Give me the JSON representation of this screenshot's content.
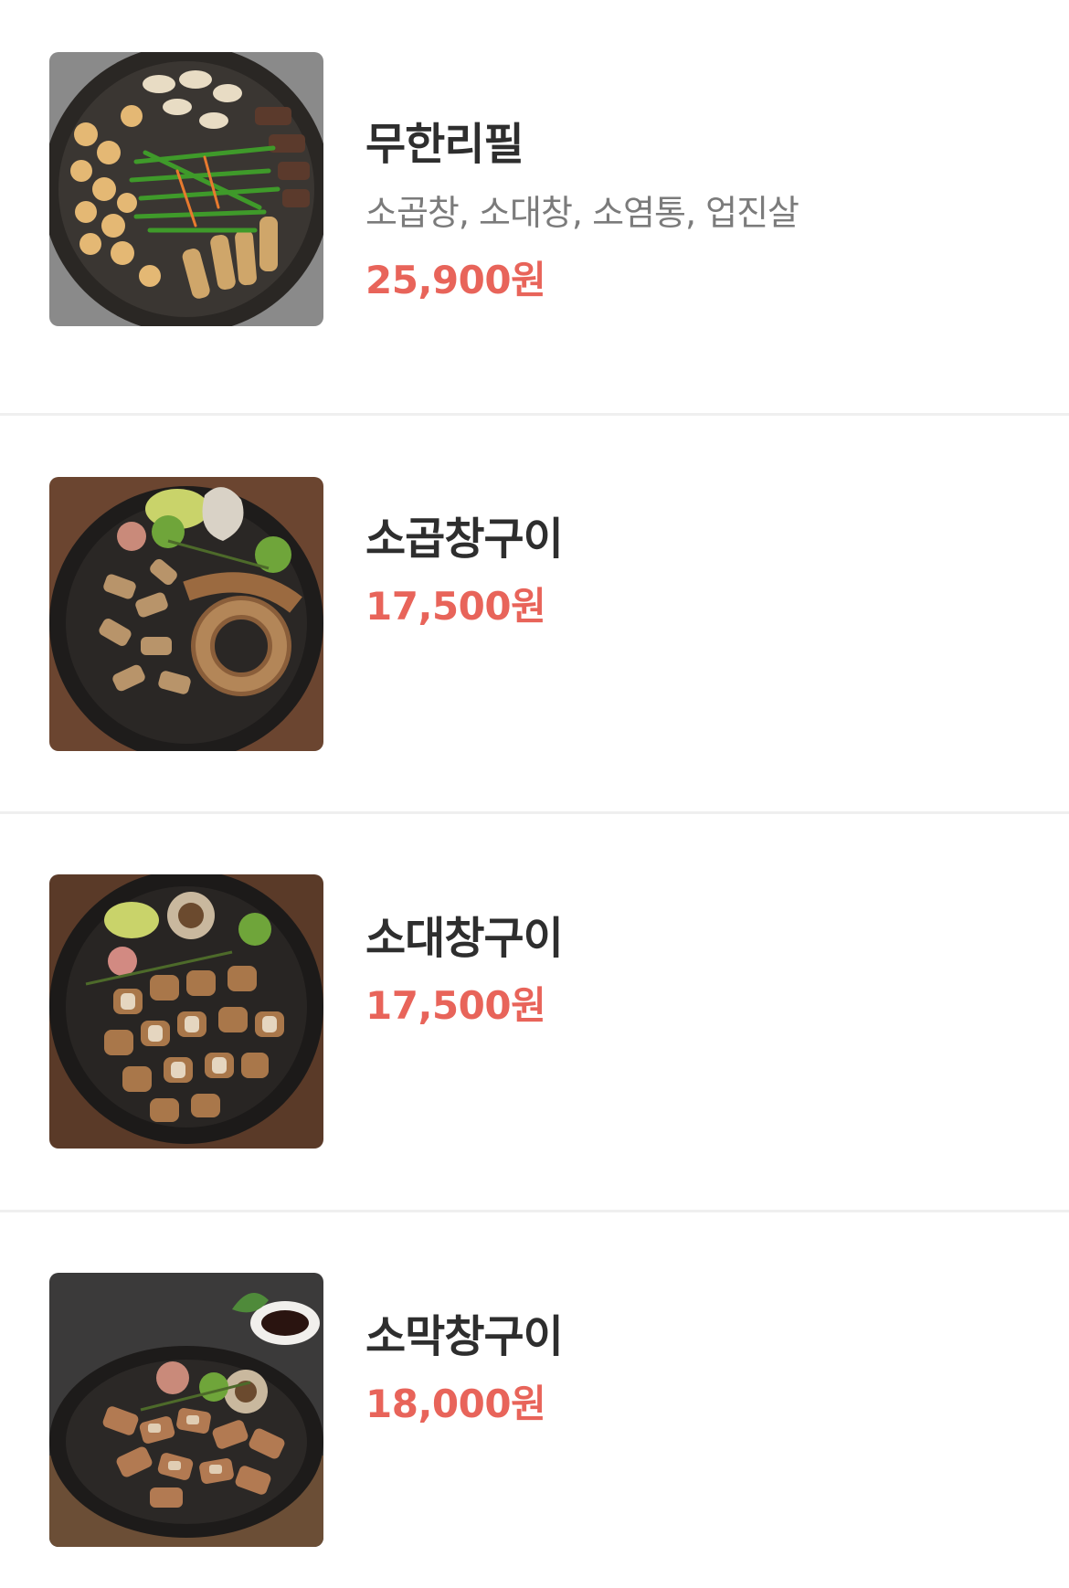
{
  "menu": {
    "items": [
      {
        "name": "무한리필",
        "description": "소곱창, 소대창, 소염통, 업진살",
        "price": "25,900원",
        "image_icon": "grilled-intestines-platter-photo"
      },
      {
        "name": "소곱창구이",
        "description": "",
        "price": "17,500원",
        "image_icon": "beef-tripe-pan-photo"
      },
      {
        "name": "소대창구이",
        "description": "",
        "price": "17,500원",
        "image_icon": "beef-large-intestine-pan-photo"
      },
      {
        "name": "소막창구이",
        "description": "",
        "price": "18,000원",
        "image_icon": "beef-abomasum-pan-photo"
      }
    ]
  },
  "colors": {
    "price": "#e8645a",
    "name": "#2e2e2e",
    "description": "#7b7b7b",
    "divider": "#efefef"
  }
}
